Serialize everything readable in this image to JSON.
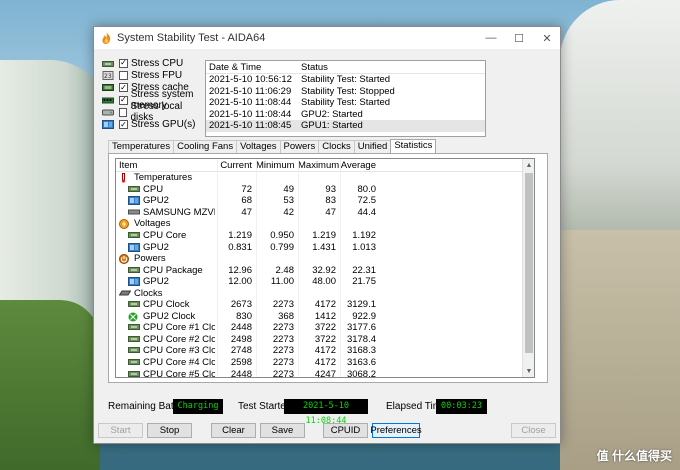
{
  "window": {
    "title": "System Stability Test - AIDA64",
    "controls": {
      "minimize": "—",
      "maximize": "☐",
      "close": "✕"
    }
  },
  "stress_options": [
    {
      "label": "Stress CPU",
      "checked": true,
      "icon": "cpu-chip-icon"
    },
    {
      "label": "Stress FPU",
      "checked": false,
      "icon": "fpu-icon"
    },
    {
      "label": "Stress cache",
      "checked": true,
      "icon": "cache-chip-icon"
    },
    {
      "label": "Stress system memory",
      "checked": true,
      "icon": "memory-module-icon"
    },
    {
      "label": "Stress local disks",
      "checked": false,
      "icon": "disk-drive-icon"
    },
    {
      "label": "Stress GPU(s)",
      "checked": true,
      "icon": "gpu-card-icon"
    }
  ],
  "log": {
    "headers": [
      "Date & Time",
      "Status"
    ],
    "rows": [
      {
        "time": "2021-5-10 10:56:12",
        "status": "Stability Test: Started"
      },
      {
        "time": "2021-5-10 11:06:29",
        "status": "Stability Test: Stopped"
      },
      {
        "time": "2021-5-10 11:08:44",
        "status": "Stability Test: Started"
      },
      {
        "time": "2021-5-10 11:08:44",
        "status": "GPU2: Started"
      },
      {
        "time": "2021-5-10 11:08:45",
        "status": "GPU1: Started"
      }
    ]
  },
  "tabs": [
    "Temperatures",
    "Cooling Fans",
    "Voltages",
    "Powers",
    "Clocks",
    "Unified",
    "Statistics"
  ],
  "active_tab": "Statistics",
  "stats": {
    "headers": [
      "Item",
      "Current",
      "Minimum",
      "Maximum",
      "Average"
    ],
    "rows": [
      {
        "kind": "group",
        "item": "Temperatures",
        "icon": "thermometer-icon"
      },
      {
        "kind": "item",
        "item": "CPU",
        "icon": "cpu-chip-icon",
        "current": "72",
        "minimum": "49",
        "maximum": "93",
        "average": "80.0"
      },
      {
        "kind": "item",
        "item": "GPU2",
        "icon": "gpu-card-icon",
        "current": "68",
        "minimum": "53",
        "maximum": "83",
        "average": "72.5"
      },
      {
        "kind": "item",
        "item": "SAMSUNG MZVLB512...",
        "icon": "ssd-drive-icon",
        "current": "47",
        "minimum": "42",
        "maximum": "47",
        "average": "44.4"
      },
      {
        "kind": "group",
        "item": "Voltages",
        "icon": "voltage-icon"
      },
      {
        "kind": "item",
        "item": "CPU Core",
        "icon": "cpu-chip-icon",
        "current": "1.219",
        "minimum": "0.950",
        "maximum": "1.219",
        "average": "1.192"
      },
      {
        "kind": "item",
        "item": "GPU2",
        "icon": "gpu-card-icon",
        "current": "0.831",
        "minimum": "0.799",
        "maximum": "1.431",
        "average": "1.013"
      },
      {
        "kind": "group",
        "item": "Powers",
        "icon": "power-icon"
      },
      {
        "kind": "item",
        "item": "CPU Package",
        "icon": "cpu-chip-icon",
        "current": "12.96",
        "minimum": "2.48",
        "maximum": "32.92",
        "average": "22.31"
      },
      {
        "kind": "item",
        "item": "GPU2",
        "icon": "gpu-card-icon",
        "current": "12.00",
        "minimum": "11.00",
        "maximum": "48.00",
        "average": "21.75"
      },
      {
        "kind": "group",
        "item": "Clocks",
        "icon": "clock-icon"
      },
      {
        "kind": "item",
        "item": "CPU Clock",
        "icon": "cpu-chip-icon",
        "current": "2673",
        "minimum": "2273",
        "maximum": "4172",
        "average": "3129.1"
      },
      {
        "kind": "item",
        "item": "GPU2 Clock",
        "icon": "xbox-gpu-icon",
        "current": "830",
        "minimum": "368",
        "maximum": "1412",
        "average": "922.9"
      },
      {
        "kind": "item",
        "item": "CPU Core #1 Clock",
        "icon": "cpu-chip-icon",
        "current": "2448",
        "minimum": "2273",
        "maximum": "3722",
        "average": "3177.6"
      },
      {
        "kind": "item",
        "item": "CPU Core #2 Clock",
        "icon": "cpu-chip-icon",
        "current": "2498",
        "minimum": "2273",
        "maximum": "3722",
        "average": "3178.4"
      },
      {
        "kind": "item",
        "item": "CPU Core #3 Clock",
        "icon": "cpu-chip-icon",
        "current": "2748",
        "minimum": "2273",
        "maximum": "4172",
        "average": "3168.3"
      },
      {
        "kind": "item",
        "item": "CPU Core #4 Clock",
        "icon": "cpu-chip-icon",
        "current": "2598",
        "minimum": "2273",
        "maximum": "4172",
        "average": "3163.6"
      },
      {
        "kind": "item",
        "item": "CPU Core #5 Clock",
        "icon": "cpu-chip-icon",
        "current": "2448",
        "minimum": "2273",
        "maximum": "4247",
        "average": "3068.2"
      }
    ]
  },
  "status": {
    "battery_label": "Remaining Battery:",
    "battery_value": "Charging",
    "started_label": "Test Started:",
    "started_value": "2021-5-10 11:08:44",
    "elapsed_label": "Elapsed Time:",
    "elapsed_value": "00:03:23"
  },
  "buttons": {
    "start": "Start",
    "stop": "Stop",
    "clear": "Clear",
    "save": "Save",
    "cpuid": "CPUID",
    "preferences": "Preferences",
    "close": "Close"
  },
  "watermark": "值 什么值得买",
  "colors": {
    "lcd_bg": "#000000",
    "lcd_text": "#00d800",
    "selection": "#e5e5e5",
    "focus": "#0078d7"
  }
}
